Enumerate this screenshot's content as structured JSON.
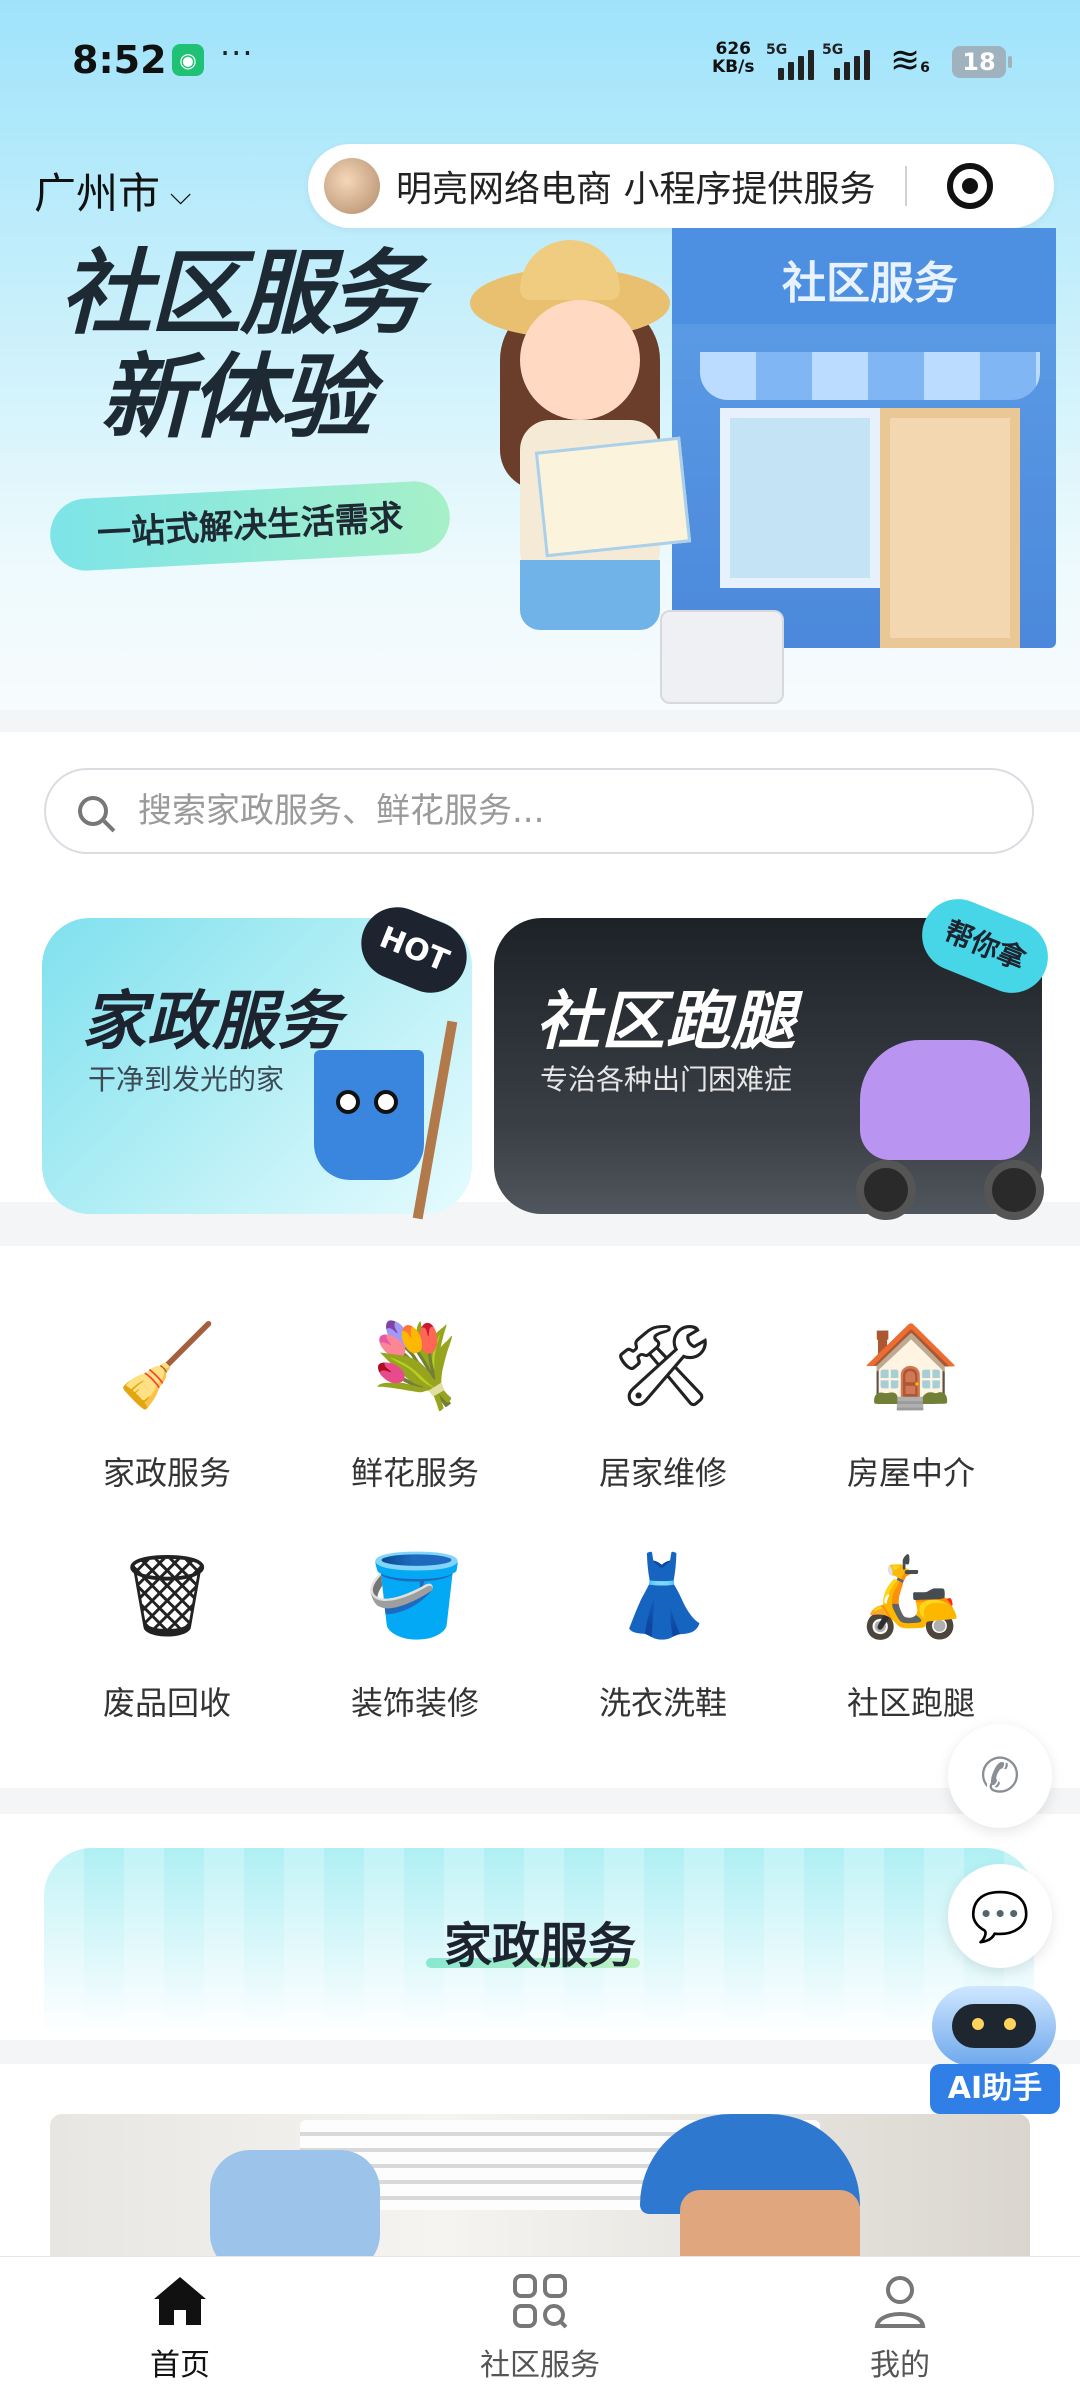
{
  "status_bar": {
    "time": "8:52",
    "more": "···",
    "speed_value": "626",
    "speed_unit": "KB/s",
    "net1": "5G",
    "net2": "5G",
    "wifi_sub": "6",
    "battery": "18"
  },
  "header": {
    "city": "广州市",
    "mini_program_note": "明亮网络电商 小程序提供服务"
  },
  "hero": {
    "title_line1": "社区服务",
    "title_line2": "新体验",
    "tagline": "一站式解决生活需求",
    "store_sign": "社区服务"
  },
  "search": {
    "placeholder": "搜索家政服务、鲜花服务..."
  },
  "feature_cards": [
    {
      "title": "家政服务",
      "subtitle": "干净到发光的家",
      "badge": "HOT"
    },
    {
      "title": "社区跑腿",
      "subtitle": "专治各种出门困难症",
      "badge": "帮你拿"
    }
  ],
  "categories": [
    {
      "label": "家政服务",
      "icon": "cleaning-tools-icon"
    },
    {
      "label": "鲜花服务",
      "icon": "flower-bouquet-icon"
    },
    {
      "label": "居家维修",
      "icon": "wrench-screwdriver-icon"
    },
    {
      "label": "房屋中介",
      "icon": "house-icon"
    },
    {
      "label": "废品回收",
      "icon": "trash-bin-icon"
    },
    {
      "label": "装饰装修",
      "icon": "paint-bucket-icon"
    },
    {
      "label": "洗衣洗鞋",
      "icon": "dress-icon"
    },
    {
      "label": "社区跑腿",
      "icon": "scooter-icon"
    }
  ],
  "section": {
    "title": "家政服务"
  },
  "floating": {
    "ai_label": "AI助手"
  },
  "tabbar": {
    "items": [
      {
        "label": "首页",
        "icon": "home-icon",
        "active": true
      },
      {
        "label": "社区服务",
        "icon": "grid-search-icon",
        "active": false
      },
      {
        "label": "我的",
        "icon": "user-icon",
        "active": false
      }
    ]
  },
  "colors": {
    "hero_gradient_top": "#9fe3fb",
    "card_home_accent": "#7fe0ee",
    "card_errand_dark": "#1d2227",
    "ai_blue": "#2f7fe6"
  }
}
